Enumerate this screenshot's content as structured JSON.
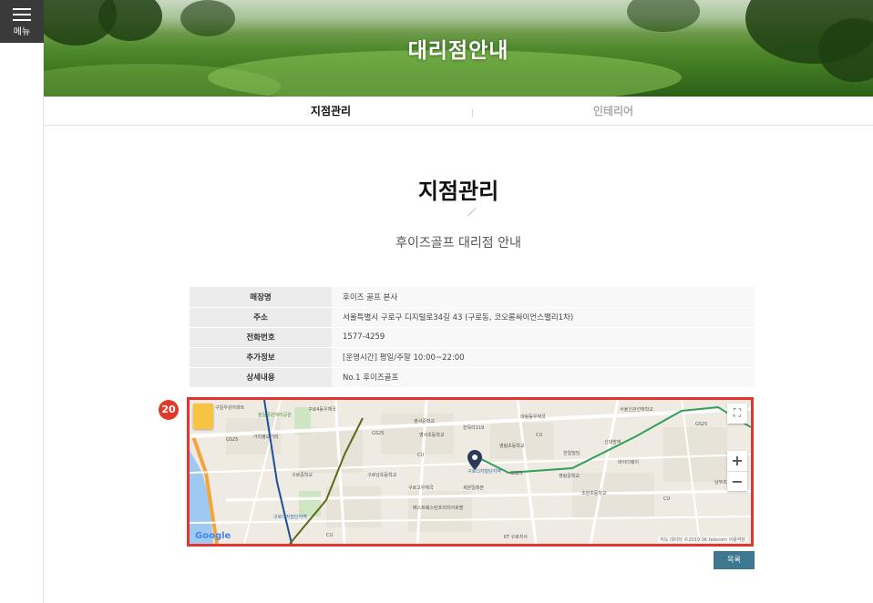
{
  "menu": {
    "label": "메뉴"
  },
  "hero": {
    "title": "대리점안내"
  },
  "tabs": [
    {
      "label": "지점관리",
      "active": true
    },
    {
      "label": "인테리어",
      "active": false
    }
  ],
  "page": {
    "title": "지점관리",
    "subtitle": "후이즈골프 대리점 안내"
  },
  "info_table": [
    {
      "label": "매장명",
      "value": "후이즈 골프 본사"
    },
    {
      "label": "주소",
      "value": "서울특별시 구로구 디지털로34길 43 (구로동, 코오롱싸이언스밸리1차)"
    },
    {
      "label": "전화번호",
      "value": "1577-4259"
    },
    {
      "label": "추가정보",
      "value": "[운영시간] 평일/주말 10:00~22:00"
    },
    {
      "label": "상세내용",
      "value": "No.1 후이즈골프"
    }
  ],
  "badge": "20",
  "map": {
    "logo": "Google",
    "attribution": "지도 데이터 ©2019 SK telecom  이용약관",
    "controls": {
      "fullscreen": "⛶",
      "zoom_in": "+",
      "zoom_out": "−"
    },
    "labels": [
      "구일우성아파트",
      "솔길공원에어공원",
      "구로4동우체국",
      "가리봉오거리",
      "영서중학교",
      "대림동우체국",
      "서울신관선택학교",
      "영서초등학교",
      "한독타119",
      "영림초등학교",
      "한일빌딩",
      "신대방역",
      "남부초교",
      "구로디지털단지역",
      "구로남초등학교",
      "구로디지털단지역",
      "가산디지털단지역",
      "구로중학교",
      "베스트웨스턴프리미어호텔",
      "조원초등학교",
      "KT 구로지사",
      "영림중학교",
      "구로고우체국",
      "바이더웨이",
      "세븐일레븐",
      "GS25",
      "CU"
    ],
    "icon_names": [
      "pegman-icon",
      "fullscreen-icon",
      "location-pin-icon"
    ]
  },
  "buttons": {
    "list": "목록"
  },
  "colors": {
    "badge": "#e03a2a",
    "map_border": "#e3342f",
    "list_button": "#3d7790",
    "menu_bg": "#3a3a3a"
  }
}
